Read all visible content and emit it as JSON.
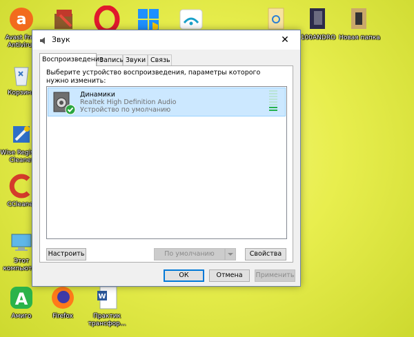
{
  "desktop": {
    "icons": [
      {
        "label": "Avast Free Antivirus"
      },
      {
        "label": "Корзина"
      },
      {
        "label": "Wise Registry Cleaner"
      },
      {
        "label": "CCleaner"
      },
      {
        "label": "Этот компьютер"
      },
      {
        "label": "Амиго"
      },
      {
        "label": "Firefox"
      },
      {
        "label": "Практик трансфор..."
      },
      {
        "label": "100ANDRO"
      },
      {
        "label": "Новая папка"
      }
    ]
  },
  "dialog": {
    "title": "Звук",
    "close_glyph": "✕",
    "tabs": [
      "Воспроизведение",
      "Запись",
      "Звуки",
      "Связь"
    ],
    "active_tab": "Воспроизведение",
    "prompt": "Выберите устройство воспроизведения, параметры которого нужно изменить:",
    "devices": [
      {
        "name": "Динамики",
        "driver": "Realtek High Definition Audio",
        "status": "Устройство по умолчанию",
        "level_bars_on": 2,
        "level_bars_total": 8
      }
    ],
    "buttons": {
      "configure": "Настроить",
      "default": "По умолчанию",
      "properties": "Свойства",
      "ok": "ОК",
      "cancel": "Отмена",
      "apply": "Применить"
    }
  },
  "colors": {
    "selection": "#cce8ff",
    "accent": "#0078d7",
    "level_on": "#22b14c"
  }
}
